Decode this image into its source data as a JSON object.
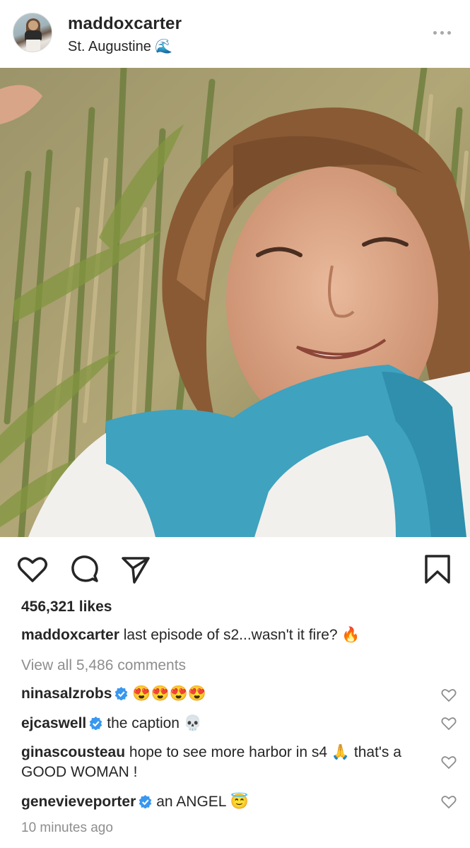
{
  "post": {
    "username": "maddoxcarter",
    "location": "St. Augustine 🌊",
    "likes": "456,321 likes",
    "caption_user": "maddoxcarter",
    "caption_text": "last episode of s2...wasn't it fire? 🔥",
    "view_all": "View all 5,486 comments",
    "time": "10 minutes ago"
  },
  "comments": [
    {
      "user": "ninasalzrobs",
      "verified": true,
      "text": "😍😍😍😍"
    },
    {
      "user": "ejcaswell",
      "verified": true,
      "text": "the caption 💀"
    },
    {
      "user": "ginascousteau",
      "verified": false,
      "text": "hope to see more harbor in s4 🙏 that's a GOOD WOMAN !"
    },
    {
      "user": "genevieveporter",
      "verified": true,
      "text": "an ANGEL 😇"
    }
  ],
  "icons": {
    "like": "heart-icon",
    "comment": "comment-bubble-icon",
    "share": "paper-plane-icon",
    "save": "bookmark-icon",
    "more": "more-dots-icon",
    "verified": "verified-badge-icon",
    "comment_like": "heart-outline-icon"
  },
  "colors": {
    "text": "#262626",
    "muted": "#8e8e8e",
    "verified": "#3897f0"
  }
}
